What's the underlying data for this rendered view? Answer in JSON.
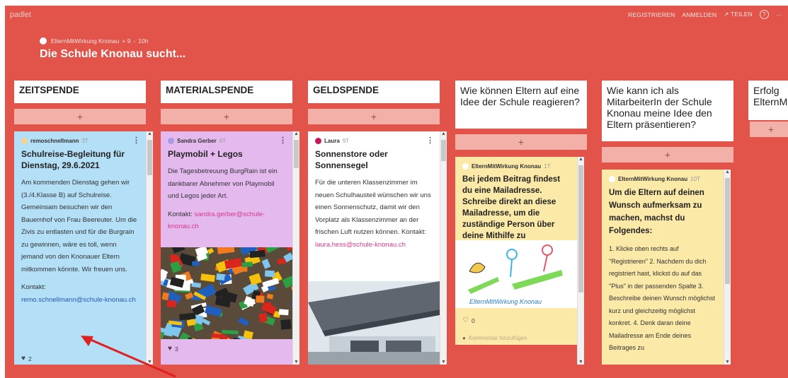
{
  "app": {
    "logo": "padlet"
  },
  "nav": {
    "register": "REGISTRIEREN",
    "login": "ANMELDEN",
    "share": "TEILEN",
    "share_icon": "↗",
    "help": "?",
    "more": "···"
  },
  "board": {
    "author": "ElternMitWirkung Knonau",
    "likes": "+ 9",
    "sep": "-",
    "age": "10h",
    "title": "Die Schule Knonau sucht..."
  },
  "columns": [
    {
      "title": "ZEITSPENDE"
    },
    {
      "title": "MATERIALSPENDE"
    },
    {
      "title": "GELDSPENDE"
    },
    {
      "title": "Wie können Eltern auf eine Idee der Schule reagieren?"
    },
    {
      "title": "Wie kann ich als MitarbeiterIn der Schule Knonau meine Idee den Eltern präsentieren?"
    },
    {
      "title": "Erfolg ElternM"
    }
  ],
  "add_label": "+",
  "cards": {
    "c1": {
      "author": "remoschnellmann",
      "time": "3T",
      "title": "Schulreise-Begleitung für Dienstag, 29.6.2021",
      "body": "Am kommenden Dienstag gehen wir (3./4.Klasse B) auf Schulreise. Gemeinsam besuchen wir den Bauernhof von Frau Beereuter. Um die Zivis zu entlasten und für die Burgrain zu gewinnen, wäre es toll, wenn jemand von den Knonauer Eltern mitkommen könnte. Wir freuen uns.",
      "contact_label": "Kontakt:",
      "contact_link": "remo.schnellmann@schule-knonau.ch",
      "likes": "2",
      "color": "#b3dff7"
    },
    "c2": {
      "author": "Sandra Gerber",
      "time": "4T",
      "title": "Playmobil + Legos",
      "body": "Die Tagesbetreuung BurgRain ist ein dankbarer Abnehmer von Playmobil und Legos jeder Art.",
      "contact_label": "Kontakt:",
      "contact_link": "sandra.gerber@schule-knonau.ch",
      "likes": "3",
      "color": "#e3b9ee"
    },
    "c3": {
      "author": "Laura",
      "time": "9T",
      "title": "Sonnenstore oder Sonnensegel",
      "body": "Für die unteren Klassenzimmer im neuen Schulhausteil wünschen wir uns einen Sonnenschutz, damit wir den Vorplatz als Klassenzimmer an der frischen Luft nutzen können.",
      "contact_label": "Kontakt:",
      "contact_link": "laura.hess@schule-knonau.ch",
      "color": "#ffffff"
    },
    "c4": {
      "author": "ElternMitWirkung Knonau",
      "time": "1T",
      "title": "Bei jedem Beitrag findest du eine Mailadresse. Schreibe direkt an diese Mailadresse, um die zuständige Person über deine Mithilfe zu informieren.",
      "image_caption": "ElternMitWirkung Knonau",
      "likes": "0",
      "comment_placeholder": "Kommentar hinzufügen",
      "color": "#fbe9a8"
    },
    "c5": {
      "author": "ElternMitWirkung Knonau",
      "time": "10T",
      "title": "Um die Eltern auf deinen Wunsch aufmerksam zu machen, machst du Folgendes:",
      "steps": "1. Klicke oben rechts auf \"Registrieren\" 2. Nachdem du dich registriert hast, klickst du auf das \"Plus\" in der passenden Spalte 3. Beschreibe deinen Wunsch möglichst kurz und gleichzeitig möglichst konkret. 4. Denk daran deine Mailadresse am Ende deines Beitrages zu",
      "color": "#fbe9a8"
    }
  },
  "colors": {
    "background": "#e2534a",
    "add_bar": "#f3b0a9",
    "arrow": "#e0211f"
  }
}
